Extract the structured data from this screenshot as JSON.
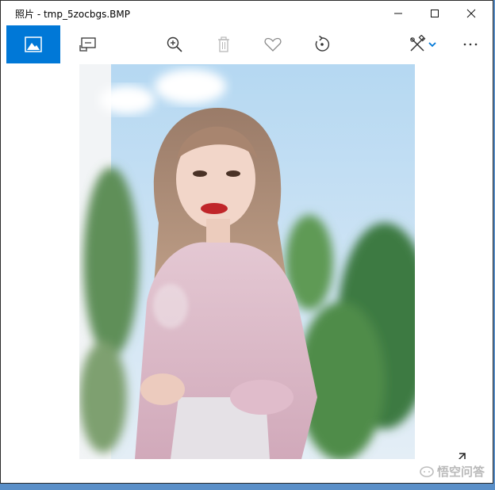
{
  "window": {
    "title": "照片 - tmp_5zocbgs.BMP"
  },
  "toolbar": {
    "items": [
      {
        "icon": "photo-icon",
        "active": true
      },
      {
        "icon": "slideshow-icon"
      },
      {
        "icon": "zoom-in-icon"
      },
      {
        "icon": "delete-icon",
        "disabled": true
      },
      {
        "icon": "heart-icon"
      },
      {
        "icon": "rotate-icon"
      },
      {
        "icon": "edit-icon"
      },
      {
        "icon": "more-icon"
      }
    ]
  },
  "watermark": {
    "text": "悟空问答"
  },
  "colors": {
    "accent": "#0078d7",
    "background": "#ffffff"
  }
}
